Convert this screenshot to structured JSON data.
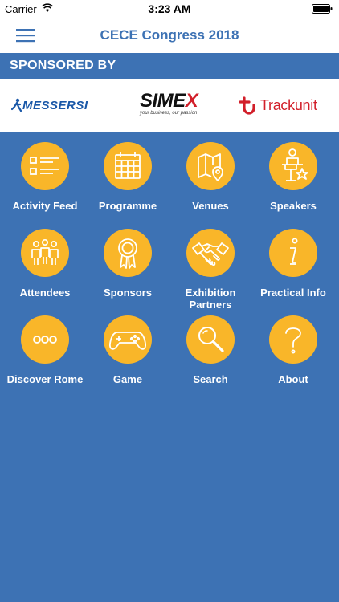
{
  "status": {
    "carrier": "Carrier",
    "time": "3:23 AM"
  },
  "nav": {
    "title": "CECE Congress 2018",
    "menu_icon": "hamburger-menu-icon"
  },
  "sponsors": {
    "header": "SPONSORED BY",
    "items": [
      {
        "name": "MESSERSI",
        "tagline": ""
      },
      {
        "name": "SIMEX",
        "tagline": "your business, our passion"
      },
      {
        "name": "Trackunit",
        "tagline": ""
      }
    ]
  },
  "tiles": [
    {
      "label": "Activity Feed",
      "icon": "list-icon"
    },
    {
      "label": "Programme",
      "icon": "calendar-icon"
    },
    {
      "label": "Venues",
      "icon": "map-pin-icon"
    },
    {
      "label": "Speakers",
      "icon": "speaker-podium-icon"
    },
    {
      "label": "Attendees",
      "icon": "people-icon"
    },
    {
      "label": "Sponsors",
      "icon": "award-ribbon-icon"
    },
    {
      "label": "Exhibition Partners",
      "icon": "handshake-icon"
    },
    {
      "label": "Practical Info",
      "icon": "info-icon"
    },
    {
      "label": "Discover Rome",
      "icon": "more-dots-icon"
    },
    {
      "label": "Game",
      "icon": "gamepad-icon"
    },
    {
      "label": "Search",
      "icon": "magnifier-icon"
    },
    {
      "label": "About",
      "icon": "question-icon"
    }
  ],
  "colors": {
    "background": "#3d72b4",
    "tile_circle": "#f9b629",
    "title_blue": "#3d72b4",
    "trackunit_red": "#d21f2a"
  }
}
